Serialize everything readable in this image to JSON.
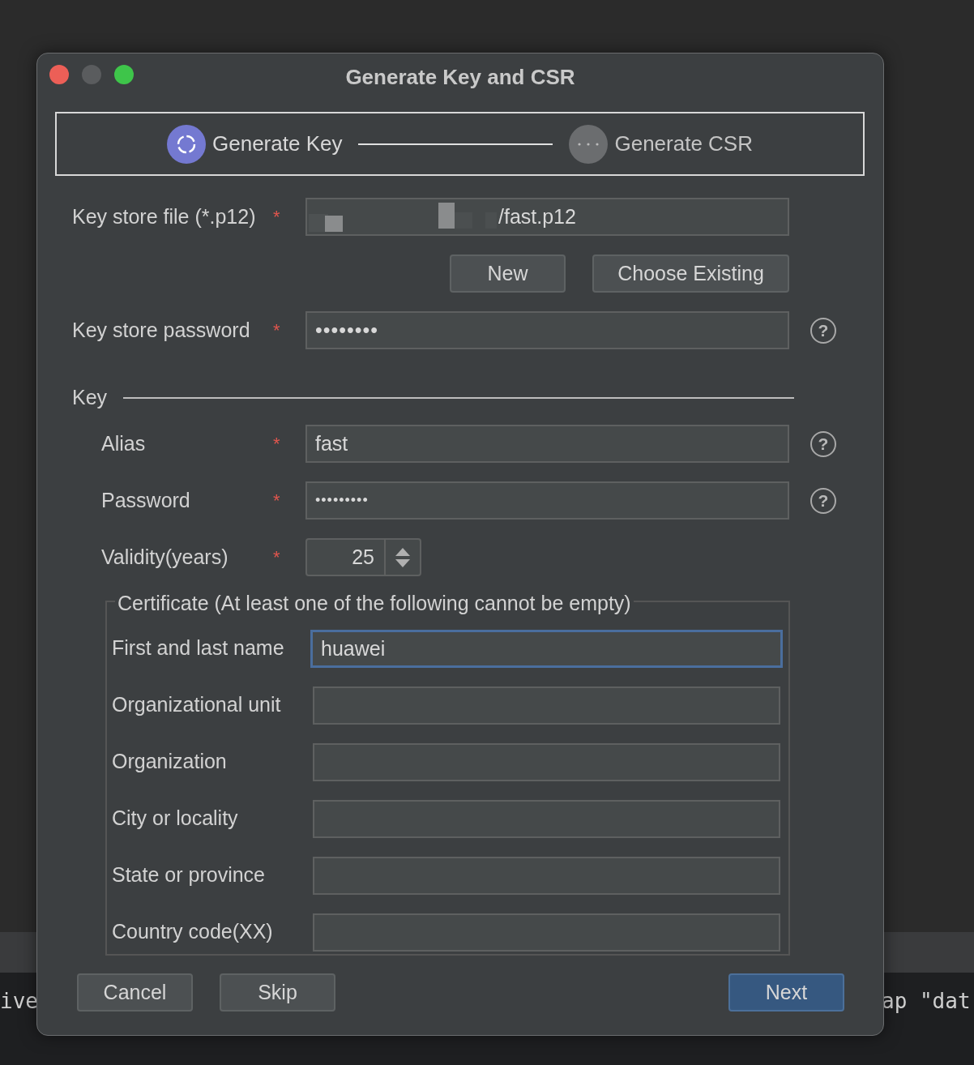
{
  "background": {
    "terminal_fragments": [
      {
        "text": "ive"
      },
      {
        "text": "ap \"dat"
      }
    ]
  },
  "window": {
    "title": "Generate Key and CSR"
  },
  "steps": [
    {
      "label": "Generate Key",
      "selected": true
    },
    {
      "label": "Generate CSR",
      "selected": false
    }
  ],
  "keystore_file": {
    "label": "Key store file (*.p12)",
    "required_mark": "*",
    "value": "/fast.p12",
    "redacted": true
  },
  "keystore_buttons": [
    "New",
    "Choose Existing"
  ],
  "keystore_password": {
    "label": "Key store password",
    "required_mark": "*",
    "value": "••••••••",
    "help": "?"
  },
  "key_section": {
    "title": "Key",
    "fields": [
      {
        "kind": "text",
        "label": "Alias",
        "required_mark": "*",
        "value": "fast",
        "help": "?"
      },
      {
        "kind": "password",
        "label": "Password",
        "required_mark": "*",
        "value": "•••••••••",
        "help": "?"
      },
      {
        "kind": "spinner",
        "label": "Validity(years)",
        "required_mark": "*",
        "value": "25"
      }
    ]
  },
  "certificate": {
    "title": "Certificate (At least one of the following cannot be empty)",
    "fields": [
      {
        "label": "First and last name",
        "value": "huawei",
        "focused": true
      },
      {
        "label": "Organizational unit",
        "focused": false
      },
      {
        "label": "Organization",
        "focused": false
      },
      {
        "label": "City or locality",
        "focused": false
      },
      {
        "label": "State or province",
        "focused": false
      },
      {
        "label": "Country code(XX)",
        "focused": false
      }
    ]
  },
  "buttons": [
    {
      "label": "Cancel",
      "kind": "secondary"
    },
    {
      "label": "Skip",
      "kind": "secondary"
    },
    {
      "label": "Next",
      "kind": "primary"
    }
  ]
}
